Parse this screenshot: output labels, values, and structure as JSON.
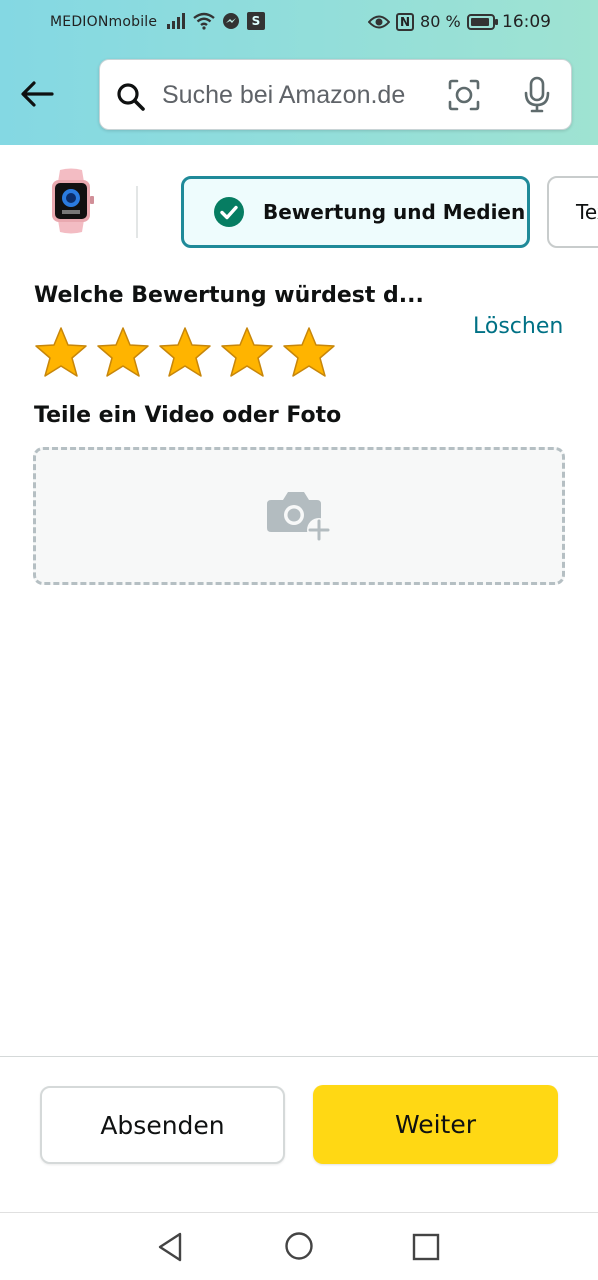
{
  "status_bar": {
    "carrier": "MEDIONmobile",
    "battery": "80 %",
    "time": "16:09",
    "s_badge": "S",
    "nfc_badge": "N"
  },
  "search": {
    "placeholder": "Suche bei Amazon.de"
  },
  "steps": {
    "active_label": "Bewertung und Medien",
    "next_label": "Text"
  },
  "rating": {
    "title": "Welche Bewertung würdest d...",
    "clear_label": "Löschen",
    "stars_selected": 5,
    "stars_total": 5
  },
  "media": {
    "title": "Teile ein Video oder Foto"
  },
  "actions": {
    "submit_label": "Absenden",
    "next_label": "Weiter"
  },
  "colors": {
    "header_gradient_start": "#84d8e3",
    "header_gradient_end": "#9fe3d2",
    "active_step_border": "#1f8a99",
    "link": "#007185",
    "primary_button": "#ffd814",
    "star": "#ffb400"
  },
  "icons": [
    "back-arrow-icon",
    "search-icon",
    "camera-icon",
    "microphone-icon",
    "check-circle-icon",
    "star-icon",
    "add-photo-icon",
    "nav-back-icon",
    "nav-home-icon",
    "nav-recent-icon"
  ]
}
